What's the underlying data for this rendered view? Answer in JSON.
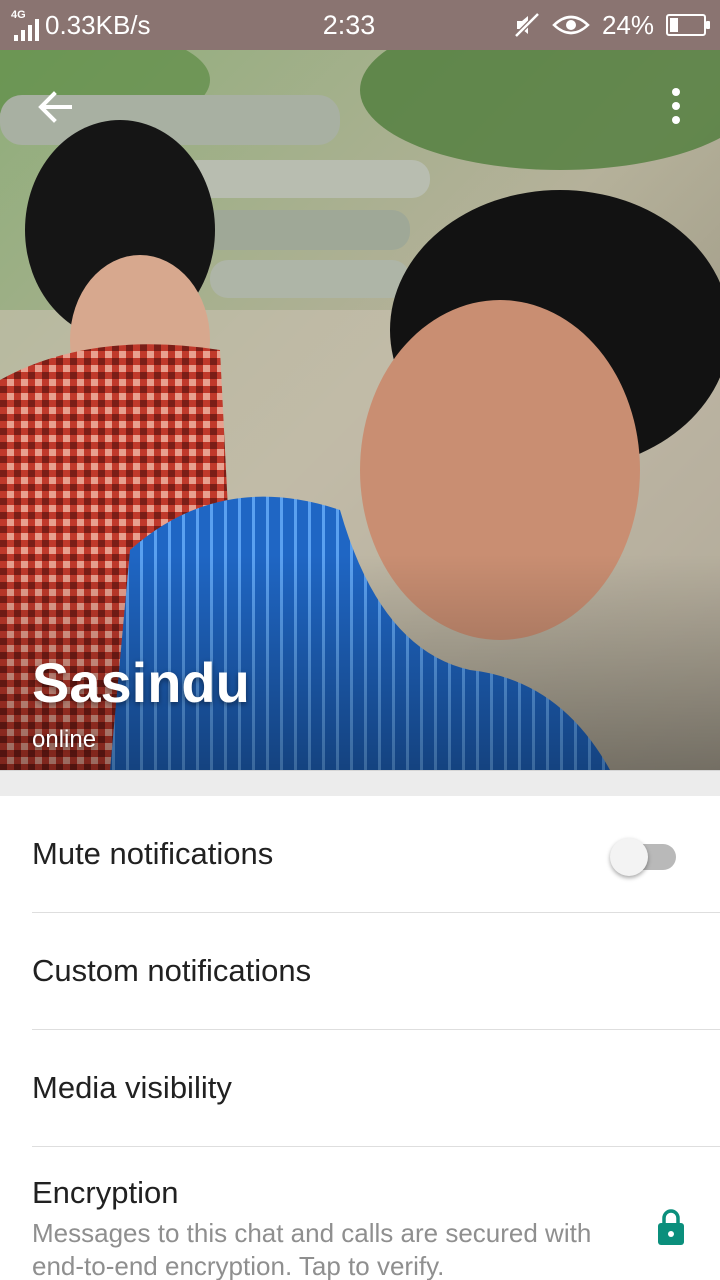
{
  "status_bar": {
    "network_type": "4G",
    "speed": "0.33KB/s",
    "time": "2:33",
    "battery": "24%",
    "battery_level": 0.24,
    "icons": [
      "signal-icon",
      "mute-icon",
      "eye-icon",
      "battery-icon"
    ]
  },
  "header": {
    "contact_name": "Sasindu",
    "contact_status": "online",
    "icons": [
      "back-arrow-icon",
      "more-vert-icon"
    ]
  },
  "settings": {
    "mute_label": "Mute notifications",
    "mute_enabled": false,
    "custom_label": "Custom notifications",
    "media_label": "Media visibility",
    "encryption_title": "Encryption",
    "encryption_subtitle": "Messages to this chat and calls are secured with end-to-end encryption. Tap to verify."
  },
  "colors": {
    "status_bar": "#8a7471",
    "accent": "#0b8f7c",
    "text_primary": "#212121",
    "text_secondary": "#8f8f8f"
  }
}
